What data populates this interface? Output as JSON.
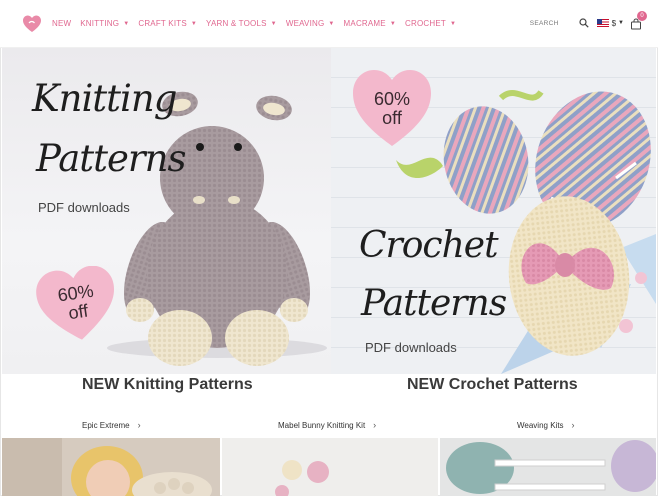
{
  "nav": {
    "menu": [
      {
        "label": "NEW",
        "dropdown": false
      },
      {
        "label": "KNITTING",
        "dropdown": true
      },
      {
        "label": "CRAFT KITS",
        "dropdown": true
      },
      {
        "label": "YARN & TOOLS",
        "dropdown": true
      },
      {
        "label": "WEAVING",
        "dropdown": true
      },
      {
        "label": "MACRAME",
        "dropdown": true
      },
      {
        "label": "CROCHET",
        "dropdown": true
      }
    ],
    "search_label": "SEARCH",
    "currency": "$",
    "cart_count": "0"
  },
  "hero_left": {
    "title_line1": "Knitting",
    "title_line2": "Patterns",
    "subtitle": "PDF downloads",
    "badge_line1": "60%",
    "badge_line2": "off"
  },
  "hero_right": {
    "title_line1": "Crochet",
    "title_line2": "Patterns",
    "subtitle": "PDF downloads",
    "badge_line1": "60%",
    "badge_line2": "off"
  },
  "sections": {
    "left_title": "NEW Knitting Patterns",
    "right_title": "NEW Crochet Patterns"
  },
  "product_links": [
    {
      "label": "Epic Extreme"
    },
    {
      "label": "Mabel Bunny Knitting Kit"
    },
    {
      "label": "Weaving Kits"
    }
  ],
  "colors": {
    "accent": "#e0678f",
    "badge_pink": "#f3b8cc"
  }
}
